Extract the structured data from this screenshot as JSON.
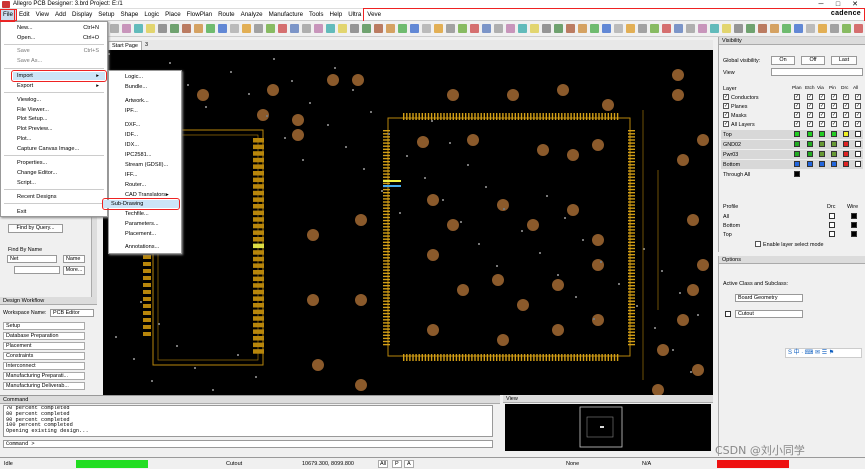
{
  "window": {
    "title": "Allegro PCB Designer: 3.brd  Project: E:/1",
    "min": "─",
    "max": "□",
    "close": "✕",
    "brand": "cadence"
  },
  "menubar": [
    "File",
    "Edit",
    "View",
    "Add",
    "Display",
    "Setup",
    "Shape",
    "Logic",
    "Place",
    "FlowPlan",
    "Route",
    "Analyze",
    "Manufacture",
    "Tools",
    "Help",
    "Ultra",
    "Veve"
  ],
  "tab": {
    "label": "Start Page",
    "num": "3"
  },
  "file_menu": {
    "items": [
      {
        "label": "New...",
        "shortcut": "Ctrl+N"
      },
      {
        "label": "Open...",
        "shortcut": "Ctrl+O"
      },
      {
        "label": "Save",
        "shortcut": "Ctrl+S"
      },
      {
        "label": "Save As...",
        "shortcut": ""
      },
      {
        "label": "Import",
        "shortcut": ""
      },
      {
        "label": "Export",
        "shortcut": ""
      },
      {
        "label": "Viewlog...",
        "shortcut": ""
      },
      {
        "label": "File Viewer...",
        "shortcut": ""
      },
      {
        "label": "Plot Setup...",
        "shortcut": ""
      },
      {
        "label": "Plot Preview...",
        "shortcut": ""
      },
      {
        "label": "Plot...",
        "shortcut": ""
      },
      {
        "label": "Capture Canvas Image...",
        "shortcut": ""
      },
      {
        "label": "Properties...",
        "shortcut": ""
      },
      {
        "label": "Change Editor...",
        "shortcut": ""
      },
      {
        "label": "Script...",
        "shortcut": ""
      },
      {
        "label": "Recent Designs",
        "shortcut": ""
      },
      {
        "label": "Exit",
        "shortcut": ""
      }
    ]
  },
  "import_menu": [
    "Logic...",
    "Bundle...",
    "Artwork...",
    "IPF...",
    "DXF...",
    "IDF...",
    "IDX...",
    "IPC2581...",
    "Stream (GDSII)...",
    "IFF...",
    "Router...",
    "CAD Translators",
    "Sub-Drawing",
    "Techfile...",
    "Parameters...",
    "Placement...",
    "Annotations..."
  ],
  "left_panel": {
    "find_by_query": "Find by Query...",
    "find_by_name": "Find By Name",
    "net": "Net",
    "name": "Name",
    "more": "More..."
  },
  "workflow": {
    "title": "Design Workflow",
    "workspace_label": "Workspace Name:",
    "workspace_value": "PCB Editor",
    "items": [
      "Setup",
      "Database Preparation",
      "Placement",
      "Constraints",
      "Interconnect",
      "Manufacturing Preparati...",
      "Manufacturing Deliverab..."
    ]
  },
  "command": {
    "title": "Command",
    "lines": [
      "70 percent completed",
      "80 percent completed",
      "90 percent completed",
      "100 percent completed",
      "Opening existing design..."
    ],
    "prompt": "Command >"
  },
  "view_panel": {
    "title": "View"
  },
  "status": {
    "mode": "Idle",
    "subclass": "Cutout",
    "coords": "10679.300, 8099.800",
    "units": "All",
    "p": "P",
    "a": "A",
    "select": "None",
    "grid": "N/A"
  },
  "visibility": {
    "title": "Visibility",
    "global": "Global visibility:",
    "on": "On",
    "off": "Off",
    "last": "Last",
    "view": "View",
    "cols_label": "Layer",
    "cols": [
      "Plan",
      "Etch",
      "Via",
      "Pin",
      "Drc",
      "All"
    ],
    "rows": [
      "Conductors",
      "Planes",
      "Masks",
      "All Layers"
    ],
    "layers": [
      "Top",
      "GND02",
      "Pwr03",
      "Bottom",
      "Through All"
    ],
    "profile": "Profile",
    "drc": "Drc",
    "wire": "Wire",
    "profile_rows": [
      "All",
      "Bottom",
      "Top"
    ],
    "enable": "Enable layer select mode"
  },
  "options": {
    "title": "Options",
    "active": "Active Class and Subclass:",
    "class": "Board Geometry",
    "subclass": "Cutout"
  },
  "watermark": "CSDN @刘小同学",
  "colors": {
    "canvas": "#000000",
    "copper": "#b8860b",
    "pad": "#d4a017",
    "via": "#8b5a2b",
    "accent": "#e22222",
    "ok_green": "#22dd22",
    "err_red": "#ee1111"
  }
}
